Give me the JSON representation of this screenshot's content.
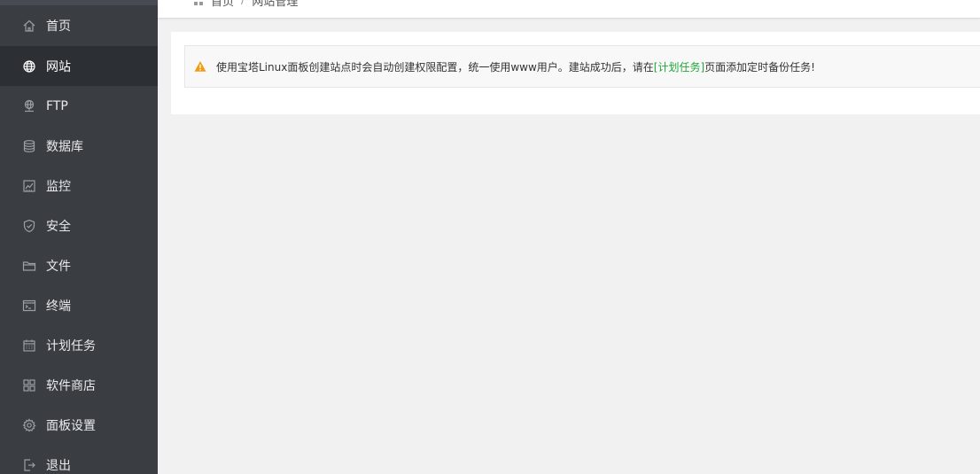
{
  "sidebar": {
    "items": [
      {
        "label": "首页",
        "icon": "home-icon"
      },
      {
        "label": "网站",
        "icon": "globe-icon",
        "active": true
      },
      {
        "label": "FTP",
        "icon": "ftp-icon"
      },
      {
        "label": "数据库",
        "icon": "database-icon"
      },
      {
        "label": "监控",
        "icon": "monitor-icon"
      },
      {
        "label": "安全",
        "icon": "shield-icon"
      },
      {
        "label": "文件",
        "icon": "folder-icon"
      },
      {
        "label": "终端",
        "icon": "terminal-icon"
      },
      {
        "label": "计划任务",
        "icon": "calendar-icon"
      },
      {
        "label": "软件商店",
        "icon": "apps-icon"
      },
      {
        "label": "面板设置",
        "icon": "gear-icon"
      },
      {
        "label": "退出",
        "icon": "logout-icon"
      }
    ]
  },
  "breadcrumb": {
    "home": "首页",
    "separator": "/",
    "current": "网站管理"
  },
  "alert": {
    "text_before": "使用宝塔Linux面板创建站点时会自动创建权限配置，统一使用www用户。建站成功后，请在",
    "link": "[计划任务]",
    "text_after": "页面添加定时备份任务!"
  },
  "colors": {
    "sidebar_bg": "#3a3e43",
    "sidebar_active_bg": "#2c3035",
    "accent_green": "#20a53a",
    "warning_orange": "#f39c12",
    "page_bg": "#f1f1f1"
  }
}
